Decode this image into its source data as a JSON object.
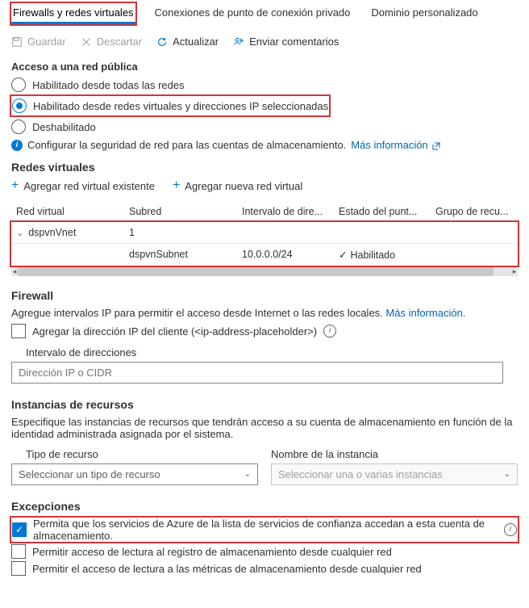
{
  "tabs": {
    "firewalls": "Firewalls y redes virtuales",
    "private": "Conexiones de punto de conexión privado",
    "domain": "Dominio personalizado"
  },
  "toolbar": {
    "save": "Guardar",
    "discard": "Descartar",
    "refresh": "Actualizar",
    "feedback": "Enviar comentarios"
  },
  "public_access": {
    "title": "Acceso a una red pública",
    "opt_all": "Habilitado desde todas las redes",
    "opt_selected": "Habilitado desde redes virtuales y direcciones IP seleccionadas",
    "opt_disabled": "Deshabilitado",
    "info_text": "Configurar la seguridad de red para las cuentas de almacenamiento.",
    "info_link": "Más información"
  },
  "vnets": {
    "title": "Redes virtuales",
    "add_existing": "Agregar red virtual existente",
    "add_new": "Agregar nueva red virtual",
    "col_vnet": "Red virtual",
    "col_subnet": "Subred",
    "col_range": "Intervalo de dire...",
    "col_endpoint": "Estado del punt...",
    "col_rg": "Grupo de recu...",
    "row_parent": {
      "name": "dspvnVnet",
      "count": "1"
    },
    "row_child": {
      "subnet": "dspvnSubnet",
      "range": "10.0.0.0/24",
      "state": "Habilitado"
    }
  },
  "firewall": {
    "title": "Firewall",
    "desc_pre": "Agregue intervalos IP para permitir el acceso desde Internet o las redes locales.",
    "desc_link": "Más información.",
    "add_client_ip": "Agregar la dirección IP del cliente (<ip-address-placeholder>)",
    "range_label": "Intervalo de direcciones",
    "range_placeholder": "Dirección IP o CIDR"
  },
  "res_instances": {
    "title": "Instancias de recursos",
    "desc": "Especifique las instancias de recursos que tendrán acceso a su cuenta de almacenamiento en función de la identidad administrada asignada por el sistema.",
    "type_label": "Tipo de recurso",
    "type_placeholder": "Seleccionar un tipo de recurso",
    "inst_label": "Nombre de la instancia",
    "inst_placeholder": "Seleccionar una o varias instancias"
  },
  "exceptions": {
    "title": "Excepciones",
    "trusted": "Permita que los servicios de Azure de la lista de servicios de confianza accedan a esta cuenta de almacenamiento.",
    "log": "Permitir acceso de lectura al registro de almacenamiento desde cualquier red",
    "metrics": "Permitir el acceso de lectura a las métricas de almacenamiento desde cualquier red"
  }
}
